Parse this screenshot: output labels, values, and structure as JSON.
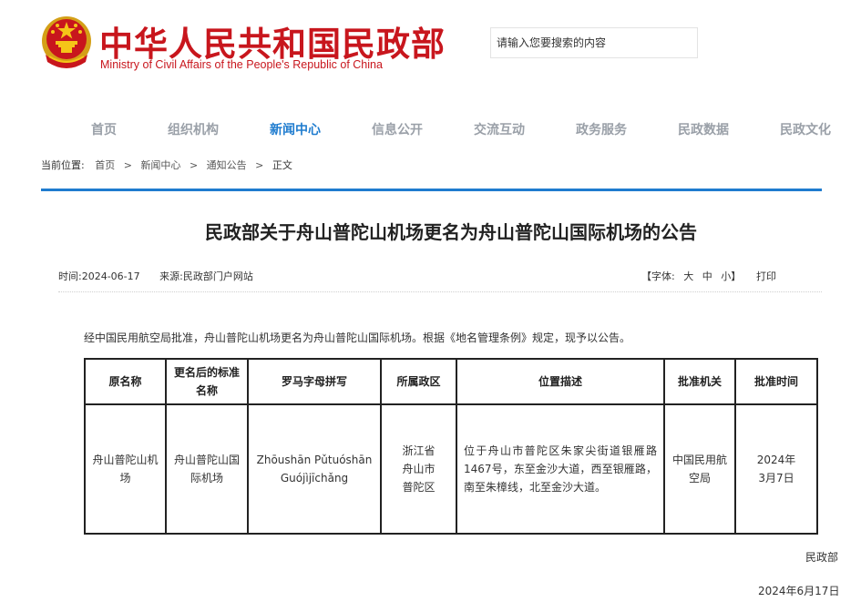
{
  "header": {
    "title_cn": "中华人民共和国民政部",
    "title_en": "Ministry of Civil Affairs of the People's Republic of China",
    "search_placeholder": "请输入您要搜索的内容",
    "emblem_icon": "national-emblem-icon"
  },
  "nav": {
    "items": [
      {
        "label": "首页"
      },
      {
        "label": "组织机构"
      },
      {
        "label": "新闻中心",
        "active": true
      },
      {
        "label": "信息公开"
      },
      {
        "label": "交流互动"
      },
      {
        "label": "政务服务"
      },
      {
        "label": "民政数据"
      },
      {
        "label": "民政文化"
      }
    ],
    "active_color": "#1f7ccf",
    "inactive_color": "#9aa0a8"
  },
  "breadcrumb": {
    "prefix": "当前位置:",
    "items": [
      "首页",
      "新闻中心",
      "通知公告"
    ],
    "current": "正文",
    "separator": ">"
  },
  "article": {
    "title": "民政部关于舟山普陀山机场更名为舟山普陀山国际机场的公告",
    "time_label": "时间:",
    "time": "2024-06-17",
    "source_label": "来源:",
    "source": "民政部门户网站",
    "font_label": "【字体:",
    "font_sizes": [
      "大",
      "中",
      "小"
    ],
    "font_close": "】",
    "print": "打印",
    "paragraph": "经中国民用航空局批准，舟山普陀山机场更名为舟山普陀山国际机场。根据《地名管理条例》规定，现予以公告。",
    "table": {
      "headers": [
        "原名称",
        "更名后的标准名称",
        "罗马字母拼写",
        "所属政区",
        "位置描述",
        "批准机关",
        "批准时间"
      ],
      "rows": [
        [
          "舟山普陀山机场",
          "舟山普陀山国际机场",
          "Zhōushān Pǔtuóshān Guójìjīchǎng",
          "浙江省舟山市普陀区",
          "位于舟山市普陀区朱家尖街道银雁路1467号，东至金沙大道，西至银雁路，南至朱樟线，北至金沙大道。",
          "中国民用航空局",
          "2024年3月7日"
        ]
      ]
    },
    "signature": "民政部",
    "date": "2024年6月17日"
  },
  "colors": {
    "brand_red": "#c8161d",
    "accent_blue": "#1f7ccf"
  }
}
